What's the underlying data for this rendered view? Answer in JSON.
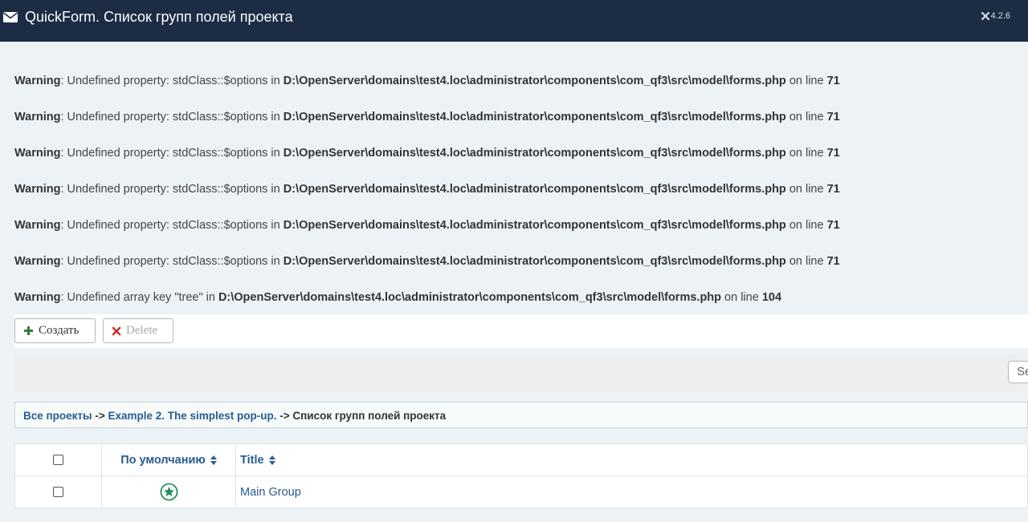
{
  "header": {
    "title": "QuickForm. Список групп полей проекта",
    "version": "4.2.6",
    "icon": "envelope-icon",
    "version_icon": "joomla-icon"
  },
  "warnings": [
    {
      "label": "Warning",
      "message": ": Undefined property: stdClass::$options in ",
      "path": "D:\\OpenServer\\domains\\test4.loc\\administrator\\components\\com_qf3\\src\\model\\forms.php",
      "on_line": " on line ",
      "line": "71"
    },
    {
      "label": "Warning",
      "message": ": Undefined property: stdClass::$options in ",
      "path": "D:\\OpenServer\\domains\\test4.loc\\administrator\\components\\com_qf3\\src\\model\\forms.php",
      "on_line": " on line ",
      "line": "71"
    },
    {
      "label": "Warning",
      "message": ": Undefined property: stdClass::$options in ",
      "path": "D:\\OpenServer\\domains\\test4.loc\\administrator\\components\\com_qf3\\src\\model\\forms.php",
      "on_line": " on line ",
      "line": "71"
    },
    {
      "label": "Warning",
      "message": ": Undefined property: stdClass::$options in ",
      "path": "D:\\OpenServer\\domains\\test4.loc\\administrator\\components\\com_qf3\\src\\model\\forms.php",
      "on_line": " on line ",
      "line": "71"
    },
    {
      "label": "Warning",
      "message": ": Undefined property: stdClass::$options in ",
      "path": "D:\\OpenServer\\domains\\test4.loc\\administrator\\components\\com_qf3\\src\\model\\forms.php",
      "on_line": " on line ",
      "line": "71"
    },
    {
      "label": "Warning",
      "message": ": Undefined property: stdClass::$options in ",
      "path": "D:\\OpenServer\\domains\\test4.loc\\administrator\\components\\com_qf3\\src\\model\\forms.php",
      "on_line": " on line ",
      "line": "71"
    },
    {
      "label": "Warning",
      "message": ": Undefined array key \"tree\" in ",
      "path": "D:\\OpenServer\\domains\\test4.loc\\administrator\\components\\com_qf3\\src\\model\\forms.php",
      "on_line": " on line ",
      "line": "104"
    }
  ],
  "toolbar": {
    "create_label": "Создать",
    "delete_label": "Delete",
    "create_icon": "plus-icon",
    "delete_icon": "close-icon"
  },
  "search": {
    "value": "Se"
  },
  "breadcrumb": {
    "all_projects": "Все проекты",
    "sep1": " -> ",
    "project": "Example 2. The simplest pop-up.",
    "sep2": " -> ",
    "current": "Список групп полей проекта"
  },
  "table": {
    "columns": {
      "default": "По умолчанию",
      "title": "Title"
    },
    "rows": [
      {
        "title": "Main Group",
        "default_icon": "star-icon"
      }
    ]
  },
  "colors": {
    "header_bg": "#1c2c44",
    "link": "#2a5b8f",
    "create_icon": "#2f7d32",
    "delete_icon": "#c9302c",
    "star": "#1f8a5c"
  }
}
